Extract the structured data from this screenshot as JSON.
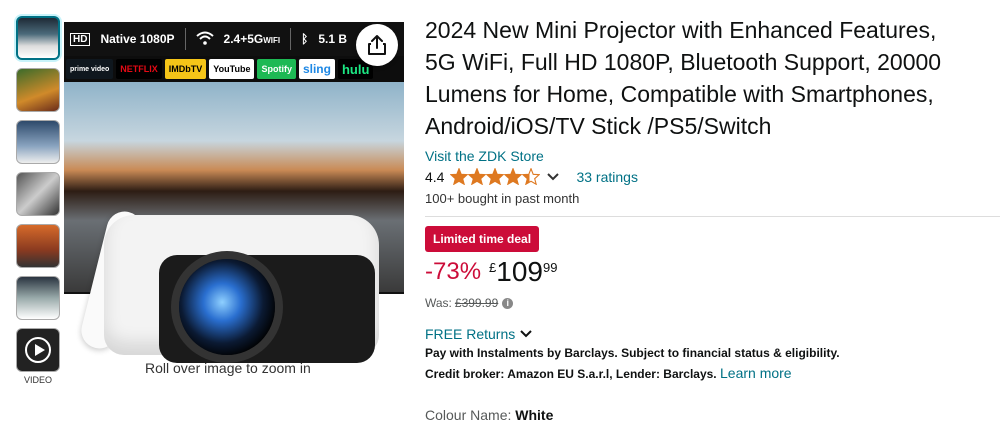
{
  "gallery": {
    "video_label": "VIDEO",
    "zoom_hint": "Roll over image to zoom in"
  },
  "banner": {
    "resolution": "Native 1080P",
    "wifi": "2.4+5G",
    "wifi_suffix": "WIFI",
    "bluetooth": "5.1 B",
    "apps": [
      "prime video",
      "NETFLIX",
      "IMDbTV",
      "YouTube",
      "Spotify",
      "sling",
      "hulu"
    ]
  },
  "product": {
    "title_lines": [
      "2024 New Mini Projector with Enhanced Features,",
      "5G WiFi, Full HD 1080P, Bluetooth Support, 20000",
      "Lumens for Home, Compatible with Smartphones,",
      "Android/iOS/TV Stick /PS5/Switch"
    ],
    "store_link": "Visit the ZDK Store",
    "rating_value": "4.4",
    "rating_stars": 4.4,
    "ratings_count": "33 ratings",
    "bought": "100+ bought in past month"
  },
  "pricing": {
    "deal_badge": "Limited time deal",
    "discount": "-73%",
    "currency": "£",
    "whole": "109",
    "fraction": "99",
    "was_label": "Was:",
    "was_price": "£399.99"
  },
  "delivery": {
    "returns": "FREE Returns",
    "instalments": "Pay with Instalments by Barclays. Subject to financial status & eligibility.",
    "credit_text": "Credit broker: Amazon EU S.a.r.l, Lender: Barclays.",
    "learn_more": "Learn more"
  },
  "variation": {
    "label": "Colour Name:",
    "value": "White"
  },
  "colors": {
    "link": "#007185",
    "deal": "#cc0c39",
    "star": "#de7921"
  }
}
